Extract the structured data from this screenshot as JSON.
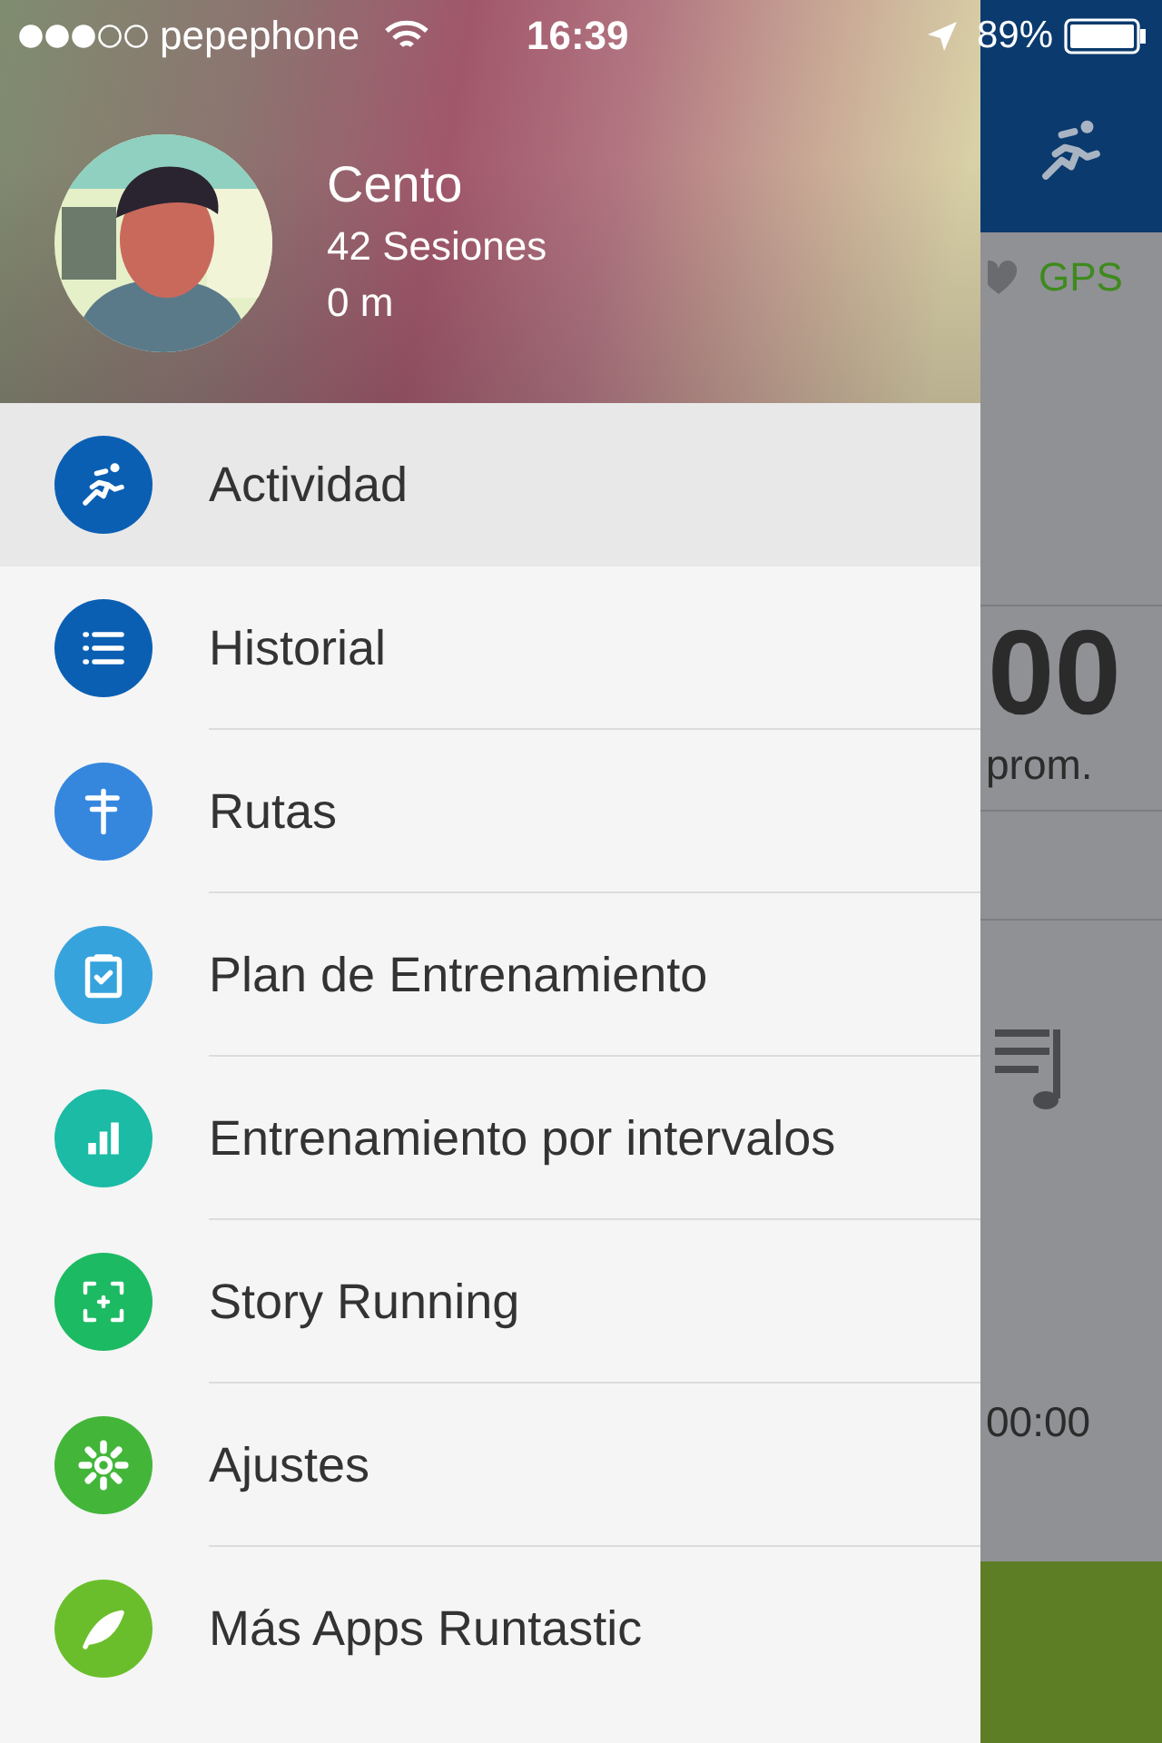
{
  "status_bar": {
    "carrier": "pepephone",
    "time": "16:39",
    "battery": "89%"
  },
  "profile": {
    "name": "Cento",
    "sessions": "42 Sesiones",
    "distance": "0 m"
  },
  "menu": [
    {
      "label": "Actividad",
      "selected": true,
      "color": "#0b5fb3"
    },
    {
      "label": "Historial",
      "selected": false,
      "color": "#0b5fb3"
    },
    {
      "label": "Rutas",
      "selected": false,
      "color": "#3587de"
    },
    {
      "label": "Plan de Entrenamiento",
      "selected": false,
      "color": "#36a3dd"
    },
    {
      "label": "Entrenamiento por intervalos",
      "selected": false,
      "color": "#1bbba5"
    },
    {
      "label": "Story Running",
      "selected": false,
      "color": "#1cba62"
    },
    {
      "label": "Ajustes",
      "selected": false,
      "color": "#43b63a"
    },
    {
      "label": "Más Apps Runtastic",
      "selected": false,
      "color": "#6bbe2b"
    }
  ],
  "background_screen": {
    "gps": "GPS",
    "pace_value": "00",
    "pace_label": "prom.",
    "time": "00:00"
  }
}
